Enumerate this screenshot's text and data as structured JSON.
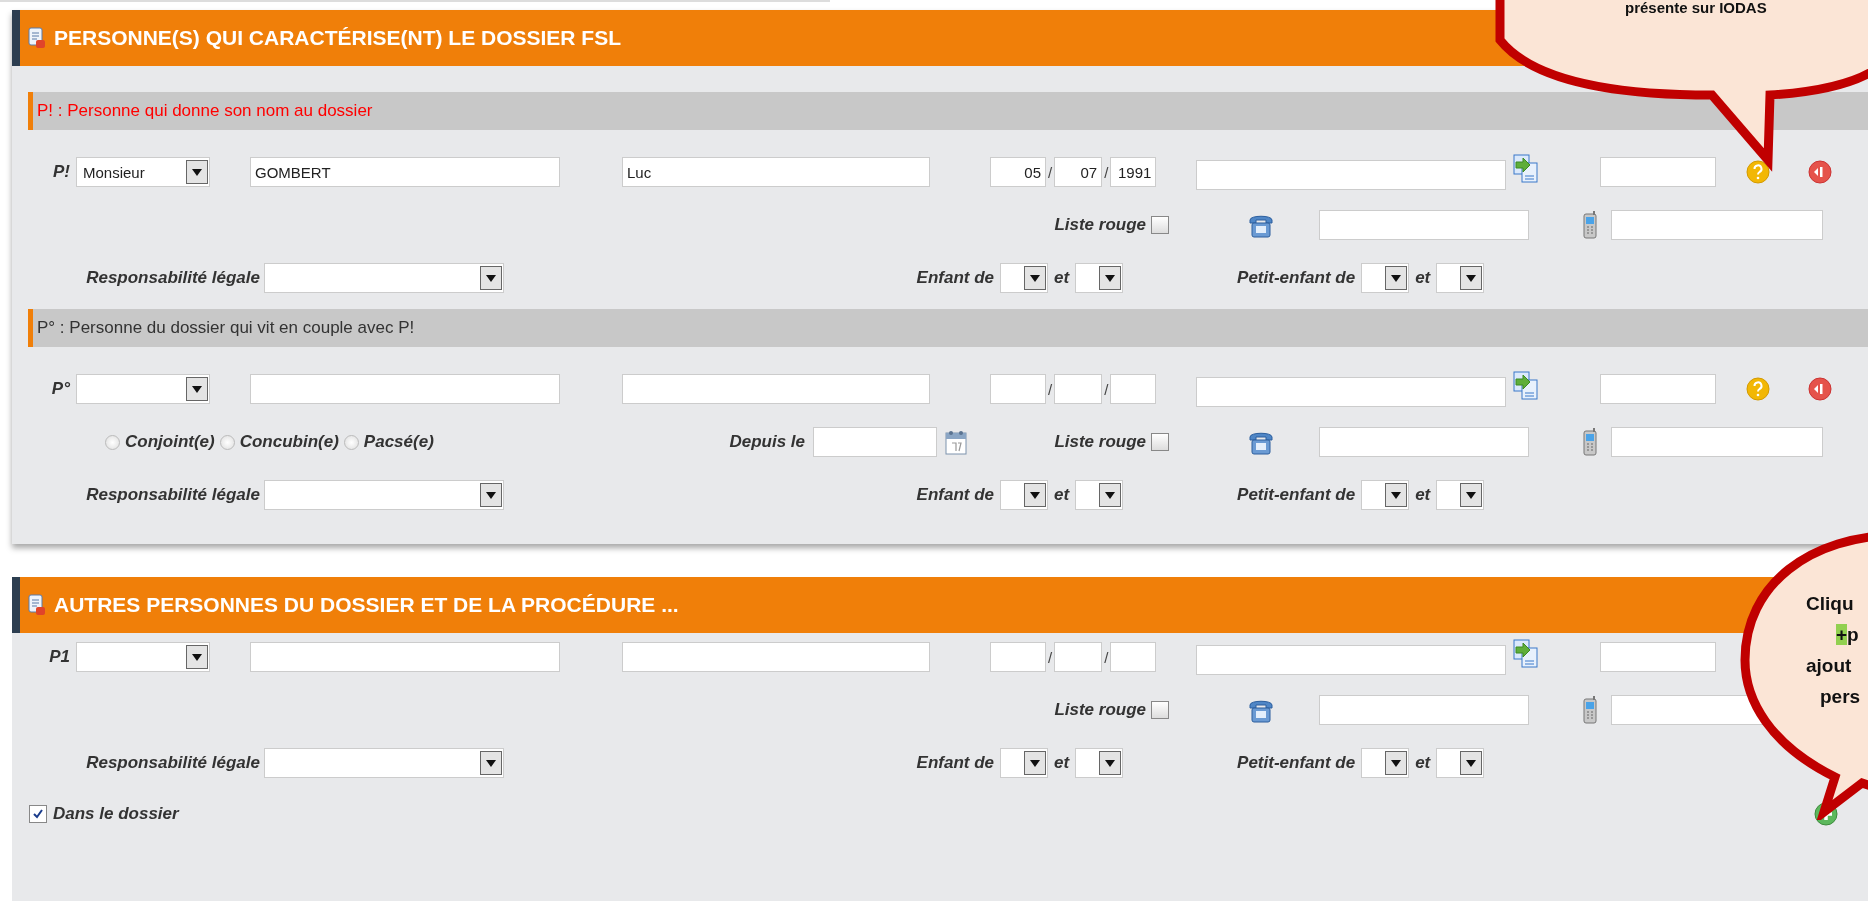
{
  "sections": [
    {
      "title": "PERSONNE(S) QUI CARACTÉRISE(NT) LE DOSSIER FSL",
      "groups": [
        {
          "heading": "P! : Personne qui donne son nom au dossier",
          "heading_alert": true,
          "person": {
            "label": "P!",
            "civility": "Monsieur",
            "last_name": "GOMBERT",
            "first_name": "Luc",
            "birth": {
              "day": "05",
              "month": "07",
              "year": "1991"
            },
            "date_separator": "/",
            "liste_rouge": {
              "label": "Liste rouge",
              "checked": false
            },
            "responsibility_label": "Responsabilité légale",
            "child_of": {
              "label": "Enfant de",
              "joiner": "et"
            },
            "grandchild_of": {
              "label": "Petit-enfant de",
              "joiner": "et"
            },
            "actions": [
              {
                "kind": "help"
              },
              {
                "kind": "delete"
              }
            ]
          }
        },
        {
          "heading": "P° : Personne du dossier qui vit en couple avec P!",
          "heading_alert": false,
          "person": {
            "label": "P°",
            "date_separator": "/",
            "couple_status": [
              {
                "label": "Conjoint(e)",
                "selected": false
              },
              {
                "label": "Concubin(e)",
                "selected": false
              },
              {
                "label": "Pacsé(e)",
                "selected": false
              }
            ],
            "since_label": "Depuis le",
            "liste_rouge": {
              "label": "Liste rouge",
              "checked": false
            },
            "responsibility_label": "Responsabilité légale",
            "child_of": {
              "label": "Enfant de",
              "joiner": "et"
            },
            "grandchild_of": {
              "label": "Petit-enfant de",
              "joiner": "et"
            },
            "actions": [
              {
                "kind": "help"
              },
              {
                "kind": "delete"
              }
            ]
          }
        }
      ]
    },
    {
      "title": "AUTRES PERSONNES DU DOSSIER ET DE LA PROCÉDURE ...",
      "groups": [
        {
          "person": {
            "label": "P1",
            "date_separator": "/",
            "liste_rouge": {
              "label": "Liste rouge",
              "checked": false
            },
            "responsibility_label": "Responsabilité légale",
            "child_of": {
              "label": "Enfant de",
              "joiner": "et"
            },
            "grandchild_of": {
              "label": "Petit-enfant de",
              "joiner": "et"
            },
            "in_dossier": {
              "label": "Dans le dossier",
              "checked": true
            },
            "footer_actions": [
              {
                "kind": "add"
              }
            ]
          }
        }
      ]
    }
  ],
  "callouts": [
    {
      "kind": "top",
      "lines": [
        {
          "text": "présente sur IODAS"
        }
      ]
    },
    {
      "kind": "side",
      "lines": [
        {
          "text": "Cliqu"
        },
        {
          "highlight": "+",
          "text": "p"
        },
        {
          "text": "ajout"
        },
        {
          "text": "pers"
        }
      ]
    }
  ]
}
